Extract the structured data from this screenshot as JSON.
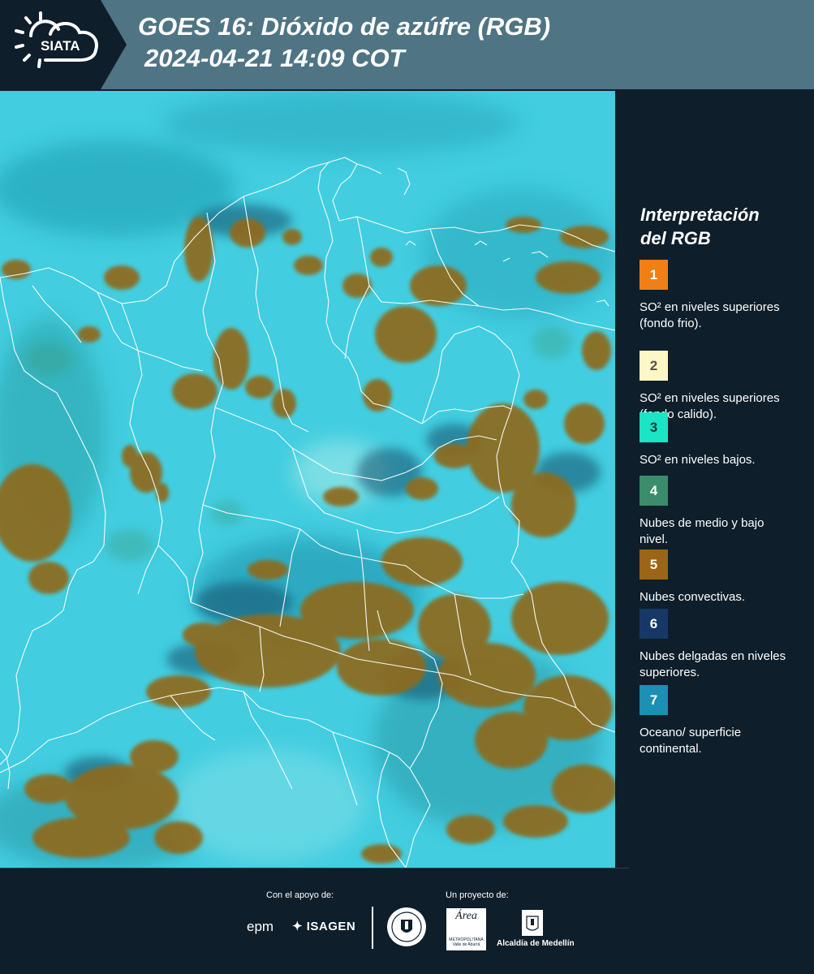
{
  "header": {
    "logo_text": "SIATA",
    "title": "GOES 16: Dióxido de azúfre (RGB)",
    "subtitle": "2024-04-21 14:09 COT"
  },
  "legend": {
    "title_line1": "Interpretación",
    "title_line2": "del RGB",
    "items": [
      {
        "number": "1",
        "color": "#f07f16",
        "text_color": "#ffffff",
        "label": "SO² en niveles superiores (fondo frio)."
      },
      {
        "number": "2",
        "color": "#fdf6c6",
        "text_color": "#5a5140",
        "label": "SO² en niveles superiores (fondo calido)."
      },
      {
        "number": "3",
        "color": "#1be5c4",
        "text_color": "#0e3a36",
        "label": "SO² en niveles bajos."
      },
      {
        "number": "4",
        "color": "#3a8c6b",
        "text_color": "#ffffff",
        "label": "Nubes de medio y bajo nivel."
      },
      {
        "number": "5",
        "color": "#9b6515",
        "text_color": "#ffffff",
        "label": "Nubes convectivas."
      },
      {
        "number": "6",
        "color": "#163866",
        "text_color": "#ffffff",
        "label": "Nubes delgadas en niveles superiores."
      },
      {
        "number": "7",
        "color": "#1b8fb4",
        "text_color": "#ffffff",
        "label": "Oceano/ superficie continental."
      }
    ]
  },
  "footer": {
    "support_label": "Con el apoyo de:",
    "project_label": "Un proyecto de:",
    "epm": "epm",
    "isagen": "ISAGEN",
    "area_text": "Área",
    "area_sub": "METROPOLITANA Valle de Aburrá",
    "alcaldia": "Alcaldía de Medellín"
  },
  "colors": {
    "background": "#0e1e2a",
    "header": "#4f7484",
    "map_base": "#42cde0",
    "convective": "#8e6a1c",
    "boundaries": "#ffffff"
  },
  "icons": [
    "sun-cloud-logo-icon",
    "isagen-star-icon",
    "medellin-seal-icon",
    "alcaldia-building-icon"
  ]
}
